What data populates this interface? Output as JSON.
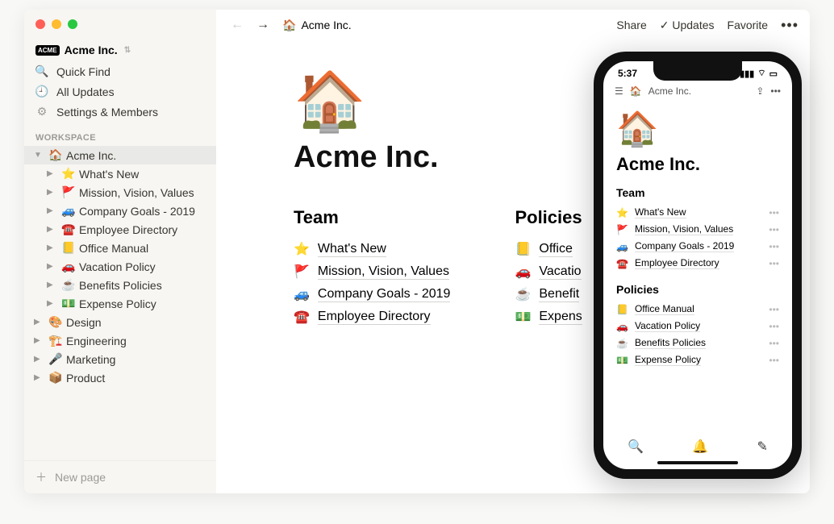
{
  "workspace_name": "Acme Inc.",
  "sidebar": {
    "quick_find": "Quick Find",
    "all_updates": "All Updates",
    "settings": "Settings & Members",
    "section_label": "WORKSPACE",
    "new_page": "New page",
    "root": {
      "emoji": "🏠",
      "label": "Acme Inc."
    },
    "children": [
      {
        "emoji": "⭐",
        "label": "What's New"
      },
      {
        "emoji": "🚩",
        "label": "Mission, Vision, Values"
      },
      {
        "emoji": "🚙",
        "label": "Company Goals - 2019"
      },
      {
        "emoji": "☎️",
        "label": "Employee Directory"
      },
      {
        "emoji": "📒",
        "label": "Office Manual"
      },
      {
        "emoji": "🚗",
        "label": "Vacation Policy"
      },
      {
        "emoji": "☕",
        "label": "Benefits Policies"
      },
      {
        "emoji": "💵",
        "label": "Expense Policy"
      }
    ],
    "siblings": [
      {
        "emoji": "🎨",
        "label": "Design"
      },
      {
        "emoji": "🏗️",
        "label": "Engineering"
      },
      {
        "emoji": "🎤",
        "label": "Marketing"
      },
      {
        "emoji": "📦",
        "label": "Product"
      }
    ]
  },
  "topbar": {
    "crumb_emoji": "🏠",
    "crumb_label": "Acme Inc.",
    "share": "Share",
    "updates": "Updates",
    "favorite": "Favorite"
  },
  "page": {
    "hero_emoji": "🏠",
    "title": "Acme Inc.",
    "col1": {
      "heading": "Team",
      "links": [
        {
          "emoji": "⭐",
          "label": "What's New"
        },
        {
          "emoji": "🚩",
          "label": "Mission, Vision, Values"
        },
        {
          "emoji": "🚙",
          "label": "Company Goals - 2019"
        },
        {
          "emoji": "☎️",
          "label": "Employee Directory"
        }
      ]
    },
    "col2": {
      "heading": "Policies",
      "links": [
        {
          "emoji": "📒",
          "label": "Office"
        },
        {
          "emoji": "🚗",
          "label": "Vacatio"
        },
        {
          "emoji": "☕",
          "label": "Benefit"
        },
        {
          "emoji": "💵",
          "label": "Expens"
        }
      ]
    }
  },
  "phone": {
    "time": "5:37",
    "crumb_emoji": "🏠",
    "crumb_label": "Acme Inc.",
    "hero_emoji": "🏠",
    "title": "Acme Inc.",
    "sec1": "Team",
    "sec1_items": [
      {
        "emoji": "⭐",
        "label": "What's New"
      },
      {
        "emoji": "🚩",
        "label": "Mission, Vision, Values"
      },
      {
        "emoji": "🚙",
        "label": "Company Goals - 2019"
      },
      {
        "emoji": "☎️",
        "label": "Employee Directory"
      }
    ],
    "sec2": "Policies",
    "sec2_items": [
      {
        "emoji": "📒",
        "label": "Office Manual"
      },
      {
        "emoji": "🚗",
        "label": "Vacation Policy"
      },
      {
        "emoji": "☕",
        "label": "Benefits Policies"
      },
      {
        "emoji": "💵",
        "label": "Expense Policy"
      }
    ]
  }
}
